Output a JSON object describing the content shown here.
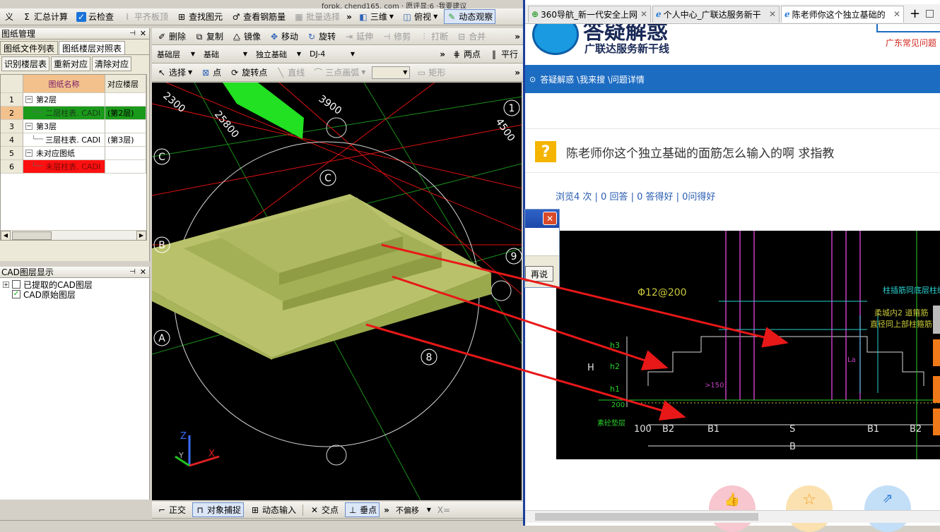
{
  "cad": {
    "top_toolbar": {
      "items": [
        "义",
        "汇总计算",
        "云检查",
        "平齐板顶",
        "查找图元",
        "查看钢筋量",
        "批量选择",
        "三维",
        "俯视",
        "动态观察"
      ],
      "top_url_text": "forpk. chend165. com · 愿评显:6 ·我要建议"
    },
    "edit_toolbar": [
      "删除",
      "复制",
      "镜像",
      "移动",
      "旋转",
      "延伸",
      "修剪",
      "打断",
      "合并"
    ],
    "layer_bar": {
      "floor": "基础层",
      "category": "基础",
      "type": "独立基础",
      "name": "DJ-4",
      "two_point": "两点",
      "parallel": "平行"
    },
    "draw_bar": [
      "选择",
      "点",
      "旋转点",
      "直线",
      "三点画弧",
      "矩形"
    ],
    "left_panel": {
      "title": "图纸管理",
      "tabs": [
        "图纸文件列表",
        "图纸楼层对照表"
      ],
      "buttons": [
        "识别楼层表",
        "重新对应",
        "清除对应"
      ],
      "headers": [
        "图纸名称",
        "对应楼层"
      ],
      "rows": [
        {
          "num": "1",
          "name": "第2层",
          "floor": "",
          "style": "group"
        },
        {
          "num": "2",
          "name": "二层柱表. CADI",
          "floor": "(第2层)",
          "style": "green"
        },
        {
          "num": "3",
          "name": "第3层",
          "floor": "",
          "style": "group"
        },
        {
          "num": "4",
          "name": "三层柱表. CADI",
          "floor": "(第3层)",
          "style": "normal"
        },
        {
          "num": "5",
          "name": "未对应图纸",
          "floor": "",
          "style": "group"
        },
        {
          "num": "6",
          "name": "未层柱表. CADI",
          "floor": "",
          "style": "red"
        }
      ],
      "cad_layer_title": "CAD图层显示",
      "layers": [
        {
          "label": "已提取的CAD图层",
          "checked": false
        },
        {
          "label": "CAD原始图层",
          "checked": true
        }
      ]
    },
    "viewport_labels": {
      "dim1": "2300",
      "dim2": "25800",
      "dim3": "3900",
      "dim4": "4500",
      "axis_c1": "C",
      "axis_c2": "C",
      "axis_b": "B",
      "axis_a": "A",
      "axis_1": "1",
      "axis_9": "9",
      "axis_8": "8",
      "z": "Z",
      "y": "Y",
      "x": "X"
    },
    "status_bar": {
      "items": [
        "正交",
        "对象捕捉",
        "动态输入",
        "交点",
        "垂点"
      ],
      "offset_label": "不偏移",
      "x_label": "X="
    }
  },
  "dialog": {
    "close": "✕",
    "button": "再说"
  },
  "browser": {
    "tabs": [
      {
        "label": "360导航_新一代安全上网",
        "active": false
      },
      {
        "label": "个人中心_广联达服务新干",
        "active": false
      },
      {
        "label": "陈老师你这个独立基础的",
        "active": true
      }
    ],
    "new_tab": "+",
    "site_title": "答疑解惑",
    "site_subtitle": "广联达服务新干线",
    "region_link": "广东常见问题",
    "breadcrumb": "答疑解惑 \\我来搜 \\问题详情",
    "question_title": "陈老师你这个独立基础的面筋怎么输入的啊 求指教",
    "stats": "浏览4 次 | 0 回答 | 0 答得好 | 0问得好",
    "drawing": {
      "rebar": "Φ12@200",
      "note1": "柱插筋同底层柱纵筋",
      "note2": "柔城内2 道箍筋",
      "note3": "直径同上部柱箍筋",
      "dims_bottom": [
        "100",
        "B2",
        "B1",
        "S",
        "B1",
        "B2"
      ],
      "dim_B": "B",
      "h_labels": [
        "h3",
        "h2",
        "h1",
        "H"
      ],
      "gt150": ">150",
      "sublayer": "素砼垫层",
      "val200": "200",
      "la": "La"
    }
  }
}
